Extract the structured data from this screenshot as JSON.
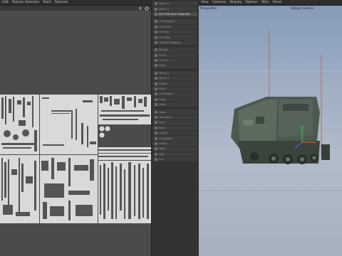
{
  "uv_editor": {
    "menu": [
      "Edit",
      "Texture Selection",
      "Paint",
      "Textures"
    ],
    "icons": [
      "pin-icon",
      "diamond-icon"
    ]
  },
  "commands": {
    "items": [
      {
        "label": "Mirror U",
        "active": false
      },
      {
        "label": "Mirror V",
        "active": false
      },
      {
        "label": "Set UVW from Projection",
        "active": true
      },
      {
        "label": "UV Polygons",
        "active": false
      },
      {
        "label": "UV Points",
        "active": false
      },
      {
        "label": "Unwrap",
        "active": false
      },
      {
        "label": "UV Relax",
        "active": false
      },
      {
        "label": "Optimal Mapping",
        "active": false
      },
      {
        "label": "Realign",
        "active": false
      },
      {
        "label": "Fit UV",
        "active": false
      },
      {
        "label": "Grid UV",
        "active": false
      },
      {
        "label": "Align",
        "active": false
      },
      {
        "label": "Mirror U",
        "active": false
      },
      {
        "label": "Mirror V",
        "active": false
      },
      {
        "label": "Rotate",
        "active": false
      },
      {
        "label": "Stack",
        "active": false
      },
      {
        "label": "UV Ranges",
        "active": false
      },
      {
        "label": "Snap",
        "active": false
      },
      {
        "label": "Scale",
        "active": false
      },
      {
        "label": "Move",
        "active": false
      },
      {
        "label": "Transform",
        "active": false
      },
      {
        "label": "Pack",
        "active": false
      },
      {
        "label": "Relax",
        "active": false
      },
      {
        "label": "Layout",
        "active": false
      },
      {
        "label": "Straighten",
        "active": false
      },
      {
        "label": "Select",
        "active": false
      },
      {
        "label": "Weld",
        "active": false
      },
      {
        "label": "Split",
        "active": false
      },
      {
        "label": "Cut",
        "active": false
      }
    ]
  },
  "viewport": {
    "menu": [
      "View",
      "Cameras",
      "Display",
      "Options",
      "Filter",
      "Panel"
    ],
    "view_label": "Perspective",
    "camera_label": "Default Camera"
  },
  "colors": {
    "uv_fill": "#d9d9d9",
    "sky_top": "#879bb8",
    "vehicle": "#4b5a4e",
    "axis_x": "#d8552b",
    "axis_y": "#3fae4f",
    "axis_z": "#3b6fd8"
  }
}
